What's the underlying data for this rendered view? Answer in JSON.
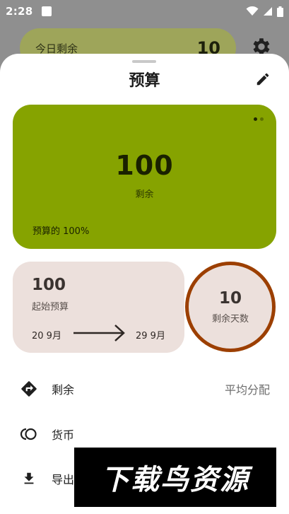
{
  "status_bar": {
    "time": "2:28"
  },
  "background": {
    "today_remaining_label": "今日剩余",
    "today_remaining_value": "10"
  },
  "sheet": {
    "title": "预算"
  },
  "green_card": {
    "amount": "100",
    "amount_label": "剩余",
    "percent_text": "预算的 100%",
    "page_count": 2,
    "active_page": 1
  },
  "beige_card": {
    "amount": "100",
    "amount_label": "起始预算",
    "date_start": "20 9月",
    "date_end": "29 9月"
  },
  "days_circle": {
    "value": "10",
    "label": "剩余天数",
    "progress": 1.0
  },
  "rows": [
    {
      "label": "剩余",
      "value": "平均分配",
      "icon": "direction-sign-icon"
    },
    {
      "label": "货币",
      "value": "",
      "icon": "currency-icon"
    },
    {
      "label": "导出",
      "value": "",
      "icon": "download-icon"
    }
  ],
  "watermark": {
    "text": "下载鸟资源"
  },
  "colors": {
    "green_card": "#86a300",
    "beige_card": "#ece0dc",
    "circle_ring": "#9c3f00"
  }
}
